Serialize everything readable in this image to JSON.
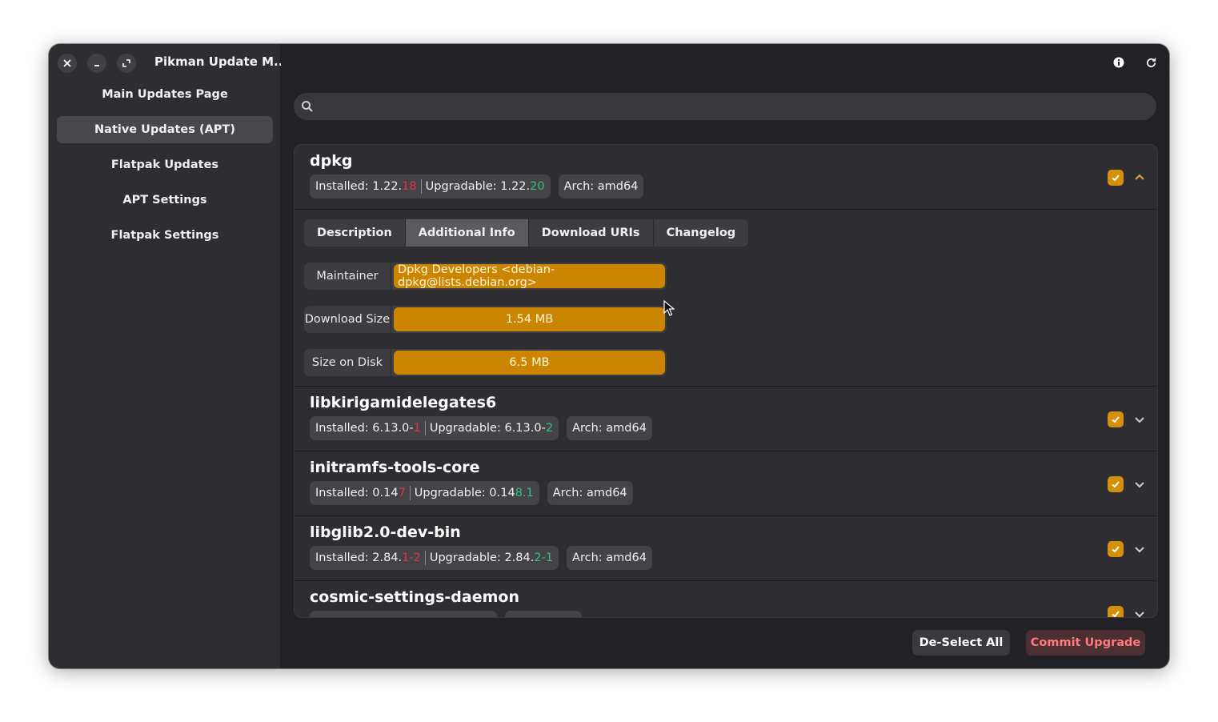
{
  "window": {
    "title": "Pikman Update M...",
    "controls": {
      "close": "✕",
      "minimize": "–",
      "maximize": "⤢"
    }
  },
  "sidebar": {
    "items": [
      {
        "label": "Main Updates Page",
        "active": false
      },
      {
        "label": "Native Updates (APT)",
        "active": true
      },
      {
        "label": "Flatpak Updates",
        "active": false
      },
      {
        "label": "APT Settings",
        "active": false
      },
      {
        "label": "Flatpak Settings",
        "active": false
      }
    ]
  },
  "toolbar": {
    "icons": [
      "info-icon",
      "refresh-icon"
    ]
  },
  "search": {
    "placeholder": "",
    "value": ""
  },
  "packages": [
    {
      "name": "dpkg",
      "installed_prefix": "Installed: 1.22.",
      "installed_diff": "18",
      "upgradable_prefix": "Upgradable: 1.22.",
      "upgradable_diff": "20",
      "arch": "Arch: amd64",
      "checked": true,
      "expanded": true
    },
    {
      "name": "libkirigamidelegates6",
      "installed_prefix": "Installed: 6.13.0-",
      "installed_diff": "1",
      "upgradable_prefix": "Upgradable: 6.13.0-",
      "upgradable_diff": "2",
      "arch": "Arch: amd64",
      "checked": true,
      "expanded": false
    },
    {
      "name": "initramfs-tools-core",
      "installed_prefix": "Installed: 0.14",
      "installed_diff": "7",
      "upgradable_prefix": "Upgradable: 0.14",
      "upgradable_diff": "8.1",
      "arch": "Arch: amd64",
      "checked": true,
      "expanded": false
    },
    {
      "name": "libglib2.0-dev-bin",
      "installed_prefix": "Installed: 2.84.",
      "installed_diff": "1-2",
      "upgradable_prefix": "Upgradable: 2.84.",
      "upgradable_diff": "2-1",
      "arch": "Arch: amd64",
      "checked": true,
      "expanded": false
    },
    {
      "name": "cosmic-settings-daemon",
      "checked": true,
      "expanded": false
    }
  ],
  "details": {
    "tabs": [
      {
        "label": "Description",
        "active": false
      },
      {
        "label": "Additional Info",
        "active": true
      },
      {
        "label": "Download URIs",
        "active": false
      },
      {
        "label": "Changelog",
        "active": false
      }
    ],
    "maintainer_label": "Maintainer",
    "maintainer_value": "Dpkg Developers <debian-dpkg@lists.debian.org>",
    "download_size_label": "Download Size",
    "download_size_value": "1.54 MB",
    "size_on_disk_label": "Size on Disk",
    "size_on_disk_value": "6.5 MB"
  },
  "footer": {
    "deselect_label": "De-Select All",
    "commit_label": "Commit Upgrade"
  },
  "colors": {
    "accent": "#cc8500",
    "checkbox": "#d4900a",
    "destructive": "#ff7b7b"
  }
}
